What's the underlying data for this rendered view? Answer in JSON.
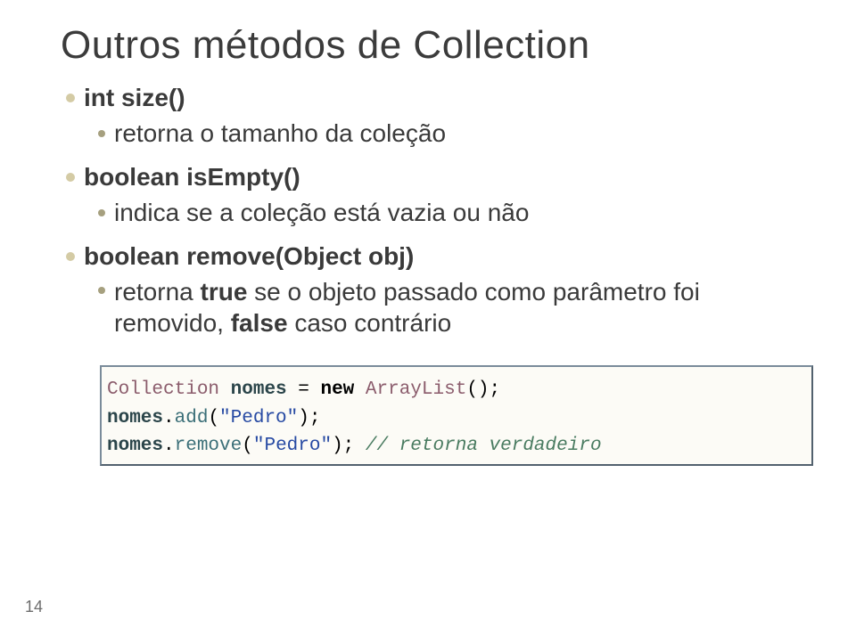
{
  "title": "Outros métodos de Collection",
  "items": [
    {
      "head": "int size()",
      "sub": "retorna o tamanho da coleção"
    },
    {
      "head": "boolean isEmpty()",
      "sub": "indica se a coleção está vazia ou não"
    },
    {
      "head": "boolean remove(Object obj)",
      "sub_prefix": "retorna ",
      "sub_bold1": "true",
      "sub_mid": " se o objeto passado como parâmetro foi removido, ",
      "sub_bold2": "false",
      "sub_suffix": " caso contrário"
    }
  ],
  "code": {
    "t_collection": "Collection",
    "t_nomes": "nomes",
    "t_eq": " = ",
    "t_new": "new",
    "t_arraylist": " ArrayList",
    "t_parens": "();",
    "t_dot": ".",
    "t_add": "add",
    "t_remove": "remove",
    "t_open": "(",
    "t_close": ");",
    "t_str_pedro": "\"Pedro\"",
    "t_comment": " // retorna verdadeiro"
  },
  "page_number": "14"
}
